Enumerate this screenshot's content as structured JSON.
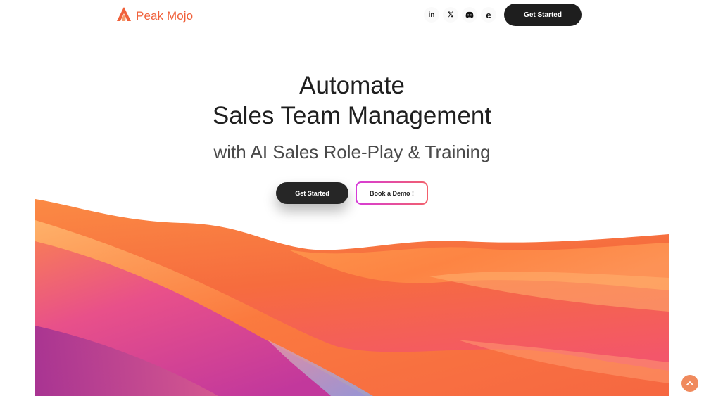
{
  "brand": {
    "name": "Peak Mojo",
    "logo_icon": "flame-peak-icon",
    "color": "#f0603a"
  },
  "nav": {
    "socials": [
      {
        "name": "linkedin",
        "glyph": "in"
      },
      {
        "name": "x",
        "glyph": "𝕏"
      },
      {
        "name": "discord",
        "glyph": "◕"
      },
      {
        "name": "e",
        "glyph": "e"
      }
    ],
    "cta_label": "Get Started"
  },
  "hero": {
    "title_line1": "Automate",
    "title_line2": "Sales Team Management",
    "subtitle": "with AI Sales Role-Play & Training",
    "primary_label": "Get Started",
    "secondary_label": "Book a Demo !"
  },
  "colors": {
    "accent": "#f0603a",
    "dark": "#1e1e1e",
    "demo_border_start": "#d63bd9",
    "demo_border_end": "#f2606b",
    "wave_orange": "#fb7a3c",
    "wave_magenta": "#c2389c",
    "scroll_top": "#f08a5d"
  },
  "scroll_top_icon": "chevron-up-icon"
}
